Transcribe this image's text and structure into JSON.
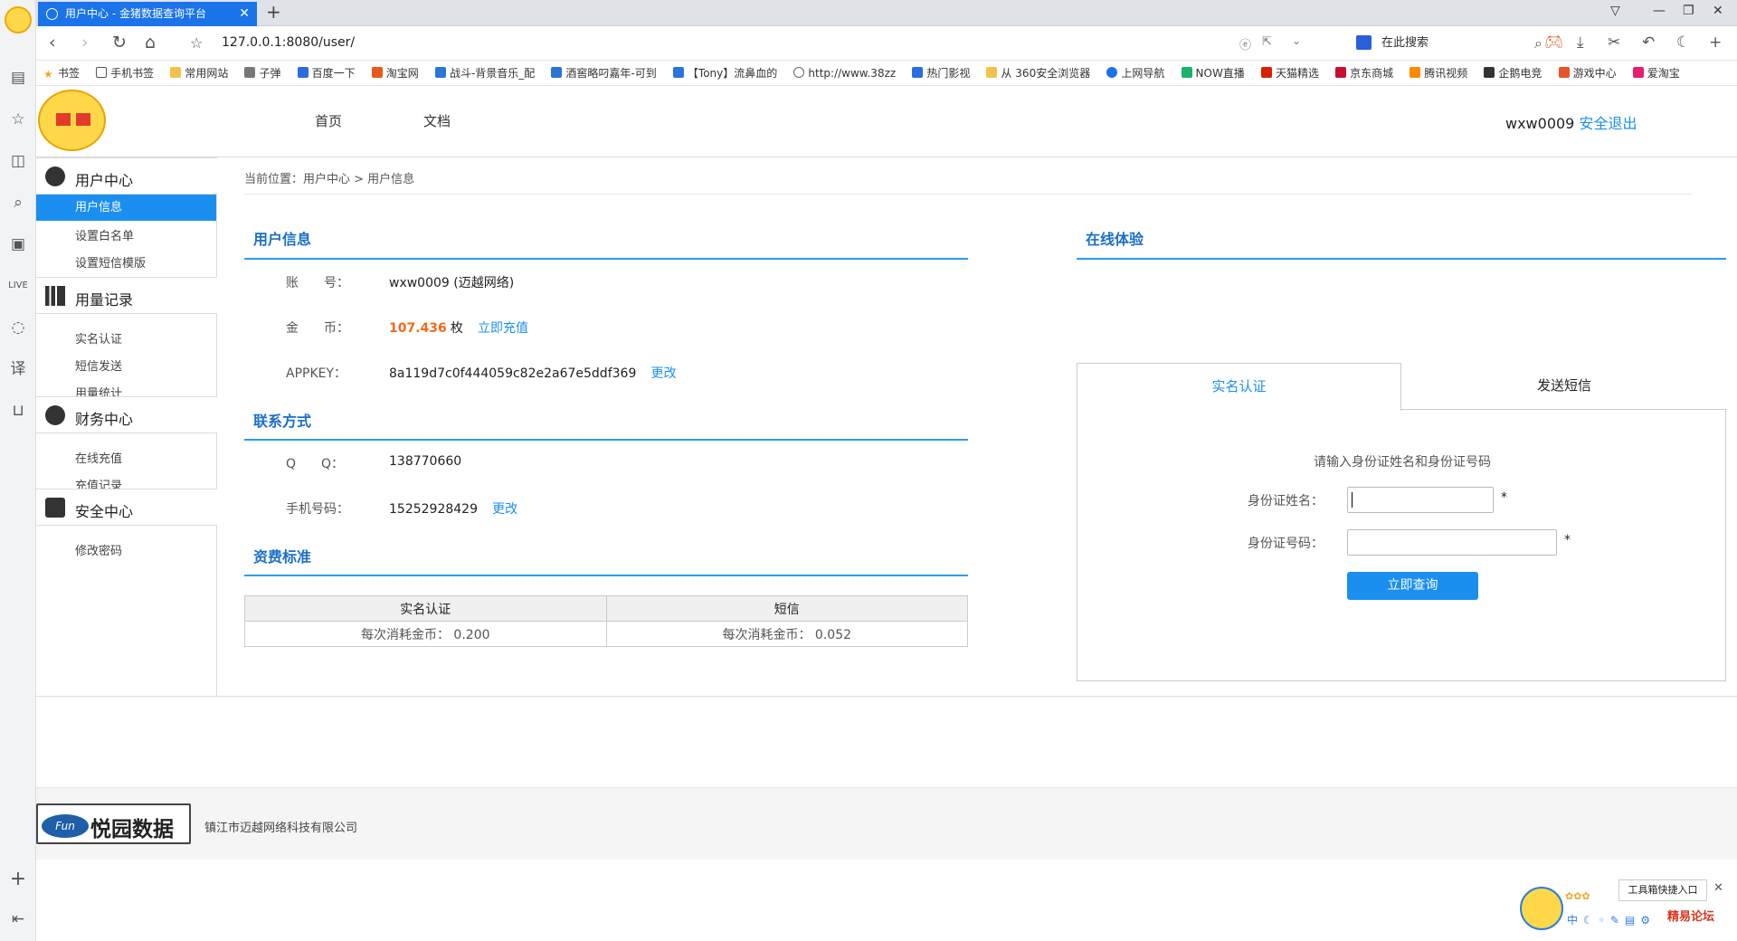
{
  "browser": {
    "tab_title": "用户中心 - 金猪数据查询平台",
    "url": "127.0.0.1:8080/user/",
    "search_placeholder": "在此搜索",
    "bookmarks": [
      "书签",
      "手机书签",
      "常用网站",
      "子弹",
      "百度一下",
      "淘宝网",
      "战斗-背景音乐_配",
      "酒窖略叼嘉年-可到",
      "【Tony】流鼻血的",
      "http://www.38zz",
      "热门影视",
      "从 360安全浏览器",
      "上网导航",
      "NOW直播",
      "天猫精选",
      "京东商城",
      "腾讯视频",
      "企鹅电竞",
      "游戏中心",
      "爱淘宝"
    ]
  },
  "header": {
    "nav": [
      "首页",
      "文档"
    ],
    "username": "wxw0009",
    "logout": "安全退出"
  },
  "menu": {
    "groups": [
      {
        "title": "用户中心",
        "items": [
          "用户信息",
          "设置白名单",
          "设置短信模版"
        ]
      },
      {
        "title": "用量记录",
        "items": [
          "实名认证",
          "短信发送",
          "用量统计"
        ]
      },
      {
        "title": "财务中心",
        "items": [
          "在线充值",
          "充值记录"
        ]
      },
      {
        "title": "安全中心",
        "items": [
          "修改密码"
        ]
      }
    ]
  },
  "breadcrumb": "当前位置：用户中心 > 用户信息",
  "user_info": {
    "title": "用户信息",
    "account_label": "账　　号：",
    "account_value": "wxw0009 (迈越网络)",
    "coin_label": "金　　币：",
    "coin_value": "107.436",
    "coin_unit": "枚",
    "recharge": "立即充值",
    "appkey_label": "APPKEY：",
    "appkey_value": "8a119d7c0f444059c82e2a67e5ddf369",
    "change": "更改"
  },
  "contact": {
    "title": "联系方式",
    "qq_label": "Q　　Q：",
    "qq_value": "138770660",
    "phone_label": "手机号码：",
    "phone_value": "15252928429",
    "change": "更改"
  },
  "pricing": {
    "title": "资费标准",
    "headers": [
      "实名认证",
      "短信"
    ],
    "row": [
      "每次消耗金币： 0.200",
      "每次消耗金币： 0.052"
    ]
  },
  "trial": {
    "title": "在线体验",
    "tabs": [
      "实名认证",
      "发送短信"
    ],
    "prompt": "请输入身份证姓名和身份证号码",
    "name_label": "身份证姓名：",
    "id_label": "身份证号码：",
    "required": "*",
    "button": "立即查询"
  },
  "footer": {
    "logo_text": "悦园数据",
    "logo_badge": "Fun",
    "company": "镇江市迈越网络科技有限公司"
  },
  "widget": {
    "toolbox": "工具箱快捷入口",
    "watermark": "精易论坛"
  },
  "colors": {
    "accent": "#1b8ff0",
    "coin": "#f26a1b",
    "tab": "#1a73e8"
  }
}
